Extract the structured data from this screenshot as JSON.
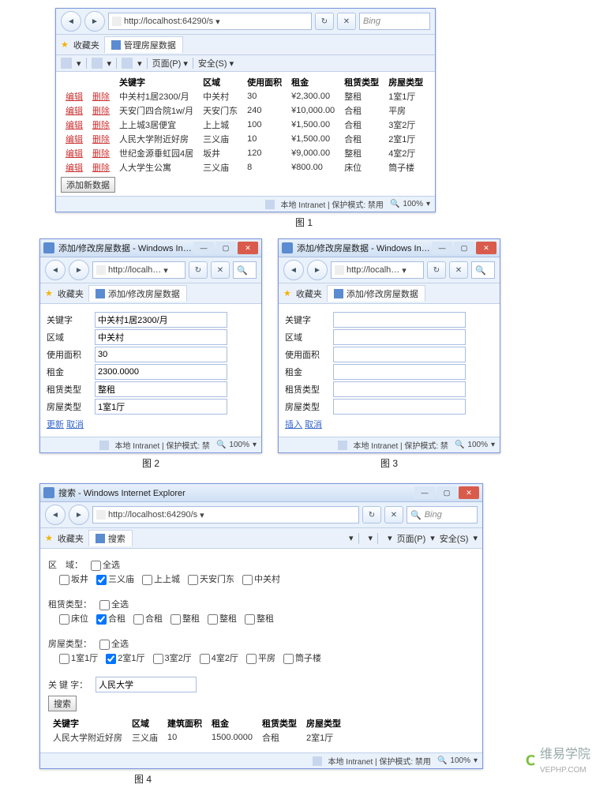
{
  "fig1": {
    "url": "http://localhost:64290/s",
    "tab": "管理房屋数据",
    "fav": "收藏夹",
    "headers": [
      "关键字",
      "区域",
      "使用面积",
      "租金",
      "租赁类型",
      "房屋类型"
    ],
    "rows": [
      {
        "edit": "编辑",
        "del": "删除",
        "kw": "中关村1居2300/月",
        "area": "中关村",
        "size": "30",
        "rent": "¥2,300.00",
        "lease": "整租",
        "type": "1室1厅"
      },
      {
        "edit": "编辑",
        "del": "删除",
        "kw": "天安门四合院1w/月",
        "area": "天安门东",
        "size": "240",
        "rent": "¥10,000.00",
        "lease": "合租",
        "type": "平房"
      },
      {
        "edit": "编辑",
        "del": "删除",
        "kw": "上上城3居便宜",
        "area": "上上城",
        "size": "100",
        "rent": "¥1,500.00",
        "lease": "合租",
        "type": "3室2厅"
      },
      {
        "edit": "编辑",
        "del": "删除",
        "kw": "人民大学附近好房",
        "area": "三义庙",
        "size": "10",
        "rent": "¥1,500.00",
        "lease": "合租",
        "type": "2室1厅"
      },
      {
        "edit": "编辑",
        "del": "删除",
        "kw": "世纪金源垂虹园4居",
        "area": "坂井",
        "size": "120",
        "rent": "¥9,000.00",
        "lease": "整租",
        "type": "4室2厅"
      },
      {
        "edit": "编辑",
        "del": "删除",
        "kw": "人大学生公寓",
        "area": "三义庙",
        "size": "8",
        "rent": "¥800.00",
        "lease": "床位",
        "type": "筒子楼"
      }
    ],
    "addbtn": "添加新数据",
    "status": "本地 Intranet | 保护模式: 禁用",
    "zoom": "100%",
    "caption": "图 1"
  },
  "fig2": {
    "title": "添加/修改房屋数据 - Windows Inte…",
    "url": "http://localh…",
    "tab": "添加/修改房屋数据",
    "fav": "收藏夹",
    "labels": {
      "kw": "关键字",
      "area": "区域",
      "size": "使用面积",
      "rent": "租金",
      "lease": "租赁类型",
      "type": "房屋类型"
    },
    "vals": {
      "kw": "中关村1居2300/月",
      "area": "中关村",
      "size": "30",
      "rent": "2300.0000",
      "lease": "整租",
      "type": "1室1厅"
    },
    "update": "更新",
    "cancel": "取消",
    "status": "本地 Intranet | 保护模式: 禁",
    "zoom": "100%",
    "caption": "图 2"
  },
  "fig3": {
    "title": "添加/修改房屋数据 - Windows Inte…",
    "url": "http://localh…",
    "tab": "添加/修改房屋数据",
    "fav": "收藏夹",
    "labels": {
      "kw": "关键字",
      "area": "区域",
      "size": "使用面积",
      "rent": "租金",
      "lease": "租赁类型",
      "type": "房屋类型"
    },
    "insert": "插入",
    "cancel": "取消",
    "status": "本地 Intranet | 保护模式: 禁",
    "zoom": "100%",
    "caption": "图 3"
  },
  "fig4": {
    "title": "搜索 - Windows Internet Explorer",
    "url": "http://localhost:64290/s",
    "search": "Bing",
    "tab": "搜索",
    "fav": "收藏夹",
    "cmd": {
      "page": "页面(P)",
      "safe": "安全(S)"
    },
    "areaLabel": "区　域：",
    "selectAll": "全选",
    "areas": [
      "坂井",
      "三义庙",
      "上上城",
      "天安门东",
      "中关村"
    ],
    "areasChecked": [
      false,
      true,
      false,
      false,
      false
    ],
    "leaseLabel": "租赁类型：",
    "leases": [
      "床位",
      "合租",
      "合租",
      "整租",
      "整租",
      "整租"
    ],
    "leasesChecked": [
      false,
      true,
      false,
      false,
      false,
      false
    ],
    "typeLabel": "房屋类型：",
    "types": [
      "1室1厅",
      "2室1厅",
      "3室2厅",
      "4室2厅",
      "平房",
      "筒子楼"
    ],
    "typesChecked": [
      false,
      true,
      false,
      false,
      false,
      false
    ],
    "kwLabel": "关 键 字：",
    "kwVal": "人民大学",
    "searchBtn": "搜索",
    "resHeaders": [
      "关键字",
      "区域",
      "建筑面积",
      "租金",
      "租赁类型",
      "房屋类型"
    ],
    "resRow": {
      "kw": "人民大学附近好房",
      "area": "三义庙",
      "size": "10",
      "rent": "1500.0000",
      "lease": "合租",
      "type": "2室1厅"
    },
    "status": "本地 Intranet | 保护模式: 禁用",
    "zoom": "100%",
    "caption": "图 4"
  },
  "watermark": {
    "main": "维易学院",
    "sub": "VEPHP.COM"
  }
}
